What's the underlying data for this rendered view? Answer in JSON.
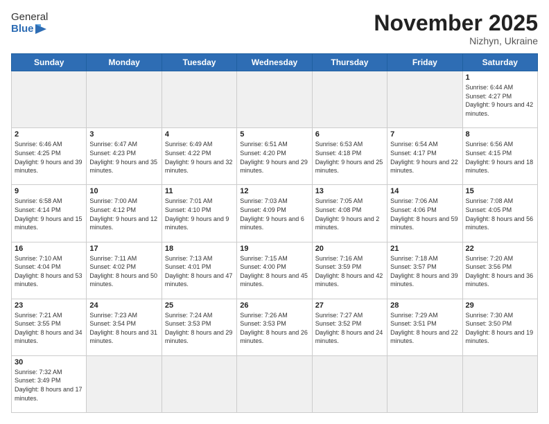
{
  "header": {
    "logo_general": "General",
    "logo_blue": "Blue",
    "month_title": "November 2025",
    "subtitle": "Nizhyn, Ukraine"
  },
  "days_of_week": [
    "Sunday",
    "Monday",
    "Tuesday",
    "Wednesday",
    "Thursday",
    "Friday",
    "Saturday"
  ],
  "weeks": [
    [
      {
        "day": "",
        "empty": true
      },
      {
        "day": "",
        "empty": true
      },
      {
        "day": "",
        "empty": true
      },
      {
        "day": "",
        "empty": true
      },
      {
        "day": "",
        "empty": true
      },
      {
        "day": "",
        "empty": true
      },
      {
        "day": "1",
        "rise": "6:44 AM",
        "set": "4:27 PM",
        "daylight": "9 hours and 42 minutes."
      }
    ],
    [
      {
        "day": "2",
        "rise": "6:46 AM",
        "set": "4:25 PM",
        "daylight": "9 hours and 39 minutes."
      },
      {
        "day": "3",
        "rise": "6:47 AM",
        "set": "4:23 PM",
        "daylight": "9 hours and 35 minutes."
      },
      {
        "day": "4",
        "rise": "6:49 AM",
        "set": "4:22 PM",
        "daylight": "9 hours and 32 minutes."
      },
      {
        "day": "5",
        "rise": "6:51 AM",
        "set": "4:20 PM",
        "daylight": "9 hours and 29 minutes."
      },
      {
        "day": "6",
        "rise": "6:53 AM",
        "set": "4:18 PM",
        "daylight": "9 hours and 25 minutes."
      },
      {
        "day": "7",
        "rise": "6:54 AM",
        "set": "4:17 PM",
        "daylight": "9 hours and 22 minutes."
      },
      {
        "day": "8",
        "rise": "6:56 AM",
        "set": "4:15 PM",
        "daylight": "9 hours and 18 minutes."
      }
    ],
    [
      {
        "day": "9",
        "rise": "6:58 AM",
        "set": "4:14 PM",
        "daylight": "9 hours and 15 minutes."
      },
      {
        "day": "10",
        "rise": "7:00 AM",
        "set": "4:12 PM",
        "daylight": "9 hours and 12 minutes."
      },
      {
        "day": "11",
        "rise": "7:01 AM",
        "set": "4:10 PM",
        "daylight": "9 hours and 9 minutes."
      },
      {
        "day": "12",
        "rise": "7:03 AM",
        "set": "4:09 PM",
        "daylight": "9 hours and 6 minutes."
      },
      {
        "day": "13",
        "rise": "7:05 AM",
        "set": "4:08 PM",
        "daylight": "9 hours and 2 minutes."
      },
      {
        "day": "14",
        "rise": "7:06 AM",
        "set": "4:06 PM",
        "daylight": "8 hours and 59 minutes."
      },
      {
        "day": "15",
        "rise": "7:08 AM",
        "set": "4:05 PM",
        "daylight": "8 hours and 56 minutes."
      }
    ],
    [
      {
        "day": "16",
        "rise": "7:10 AM",
        "set": "4:04 PM",
        "daylight": "8 hours and 53 minutes."
      },
      {
        "day": "17",
        "rise": "7:11 AM",
        "set": "4:02 PM",
        "daylight": "8 hours and 50 minutes."
      },
      {
        "day": "18",
        "rise": "7:13 AM",
        "set": "4:01 PM",
        "daylight": "8 hours and 47 minutes."
      },
      {
        "day": "19",
        "rise": "7:15 AM",
        "set": "4:00 PM",
        "daylight": "8 hours and 45 minutes."
      },
      {
        "day": "20",
        "rise": "7:16 AM",
        "set": "3:59 PM",
        "daylight": "8 hours and 42 minutes."
      },
      {
        "day": "21",
        "rise": "7:18 AM",
        "set": "3:57 PM",
        "daylight": "8 hours and 39 minutes."
      },
      {
        "day": "22",
        "rise": "7:20 AM",
        "set": "3:56 PM",
        "daylight": "8 hours and 36 minutes."
      }
    ],
    [
      {
        "day": "23",
        "rise": "7:21 AM",
        "set": "3:55 PM",
        "daylight": "8 hours and 34 minutes."
      },
      {
        "day": "24",
        "rise": "7:23 AM",
        "set": "3:54 PM",
        "daylight": "8 hours and 31 minutes."
      },
      {
        "day": "25",
        "rise": "7:24 AM",
        "set": "3:53 PM",
        "daylight": "8 hours and 29 minutes."
      },
      {
        "day": "26",
        "rise": "7:26 AM",
        "set": "3:53 PM",
        "daylight": "8 hours and 26 minutes."
      },
      {
        "day": "27",
        "rise": "7:27 AM",
        "set": "3:52 PM",
        "daylight": "8 hours and 24 minutes."
      },
      {
        "day": "28",
        "rise": "7:29 AM",
        "set": "3:51 PM",
        "daylight": "8 hours and 22 minutes."
      },
      {
        "day": "29",
        "rise": "7:30 AM",
        "set": "3:50 PM",
        "daylight": "8 hours and 19 minutes."
      }
    ],
    [
      {
        "day": "30",
        "rise": "7:32 AM",
        "set": "3:49 PM",
        "daylight": "8 hours and 17 minutes."
      },
      {
        "day": "",
        "empty": true
      },
      {
        "day": "",
        "empty": true
      },
      {
        "day": "",
        "empty": true
      },
      {
        "day": "",
        "empty": true
      },
      {
        "day": "",
        "empty": true
      },
      {
        "day": "",
        "empty": true
      }
    ]
  ]
}
